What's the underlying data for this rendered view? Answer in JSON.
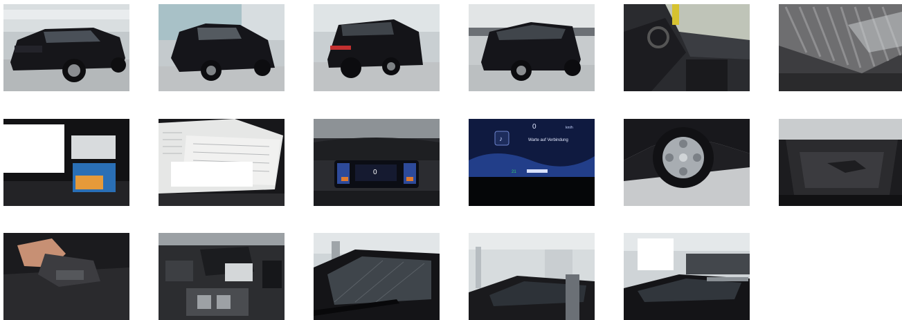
{
  "gallery": {
    "images": [
      {
        "id": "exterior-front-left"
      },
      {
        "id": "exterior-front-left-2"
      },
      {
        "id": "exterior-rear-left"
      },
      {
        "id": "exterior-rear-left-2"
      },
      {
        "id": "interior-driver-seat"
      },
      {
        "id": "roof-rail-detail"
      },
      {
        "id": "documents-booklet"
      },
      {
        "id": "service-book"
      },
      {
        "id": "dashboard-cluster"
      },
      {
        "id": "infotainment-screen",
        "screen_text": "Warte auf Verbindung",
        "screen_unit": "km/h"
      },
      {
        "id": "wheel-rim"
      },
      {
        "id": "trunk-open"
      },
      {
        "id": "trunk-tools"
      },
      {
        "id": "engine-bay"
      },
      {
        "id": "windshield"
      },
      {
        "id": "roof-view"
      },
      {
        "id": "roof-view-2"
      }
    ]
  },
  "colors": {
    "page_bg": "#ffffff",
    "car_body": "#17171b",
    "floor": "#bfc3c5",
    "wall": "#cfd6d9"
  }
}
